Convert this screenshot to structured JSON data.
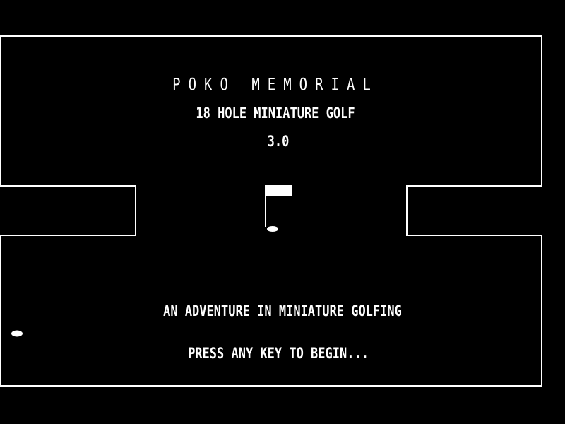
{
  "title_screen": {
    "game_title": "POKO MEMORIAL",
    "subtitle": "18 HOLE MINIATURE GOLF",
    "version": "3.0",
    "tagline": "AN ADVENTURE IN MINIATURE GOLFING",
    "start_prompt": "PRESS ANY KEY TO BEGIN..."
  },
  "colors": {
    "background": "#000000",
    "foreground": "#ffffff"
  },
  "icons": {
    "flag": "hole-flag-icon",
    "ball": "golf-ball-icon"
  }
}
